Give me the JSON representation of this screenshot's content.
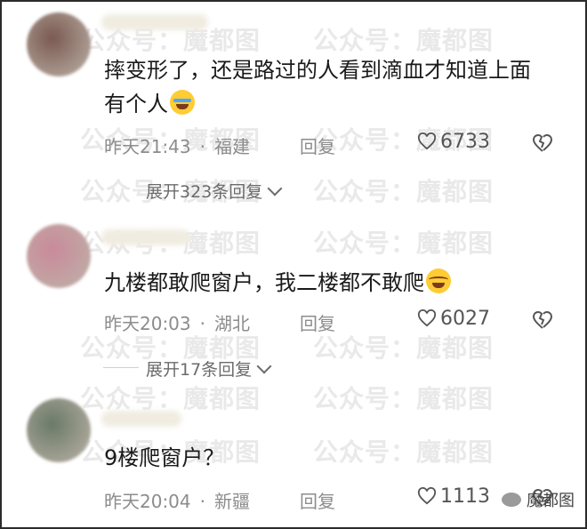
{
  "watermark": {
    "text": "公众号：魔都图"
  },
  "comments": [
    {
      "text": "摔变形了，还是路过的人看到滴血才知道上面有个人",
      "emoji": "crying-face",
      "time": "昨天21:43",
      "location": "福建",
      "reply_label": "回复",
      "likes": "6733",
      "expand_label": "展开323条回复",
      "avatar_color": "#7a5a52"
    },
    {
      "text": "九楼都敢爬窗户，我二楼都不敢爬",
      "emoji": "laughing-face",
      "time": "昨天20:03",
      "location": "湖北",
      "reply_label": "回复",
      "likes": "6027",
      "expand_label": "展开17条回复",
      "avatar_color": "#c98a9a"
    },
    {
      "text": "9楼爬窗户？",
      "time": "昨天20:04",
      "location": "新疆",
      "reply_label": "回复",
      "likes": "1113",
      "avatar_color": "#6a7a68"
    }
  ],
  "logo": {
    "text": "魔都图"
  }
}
